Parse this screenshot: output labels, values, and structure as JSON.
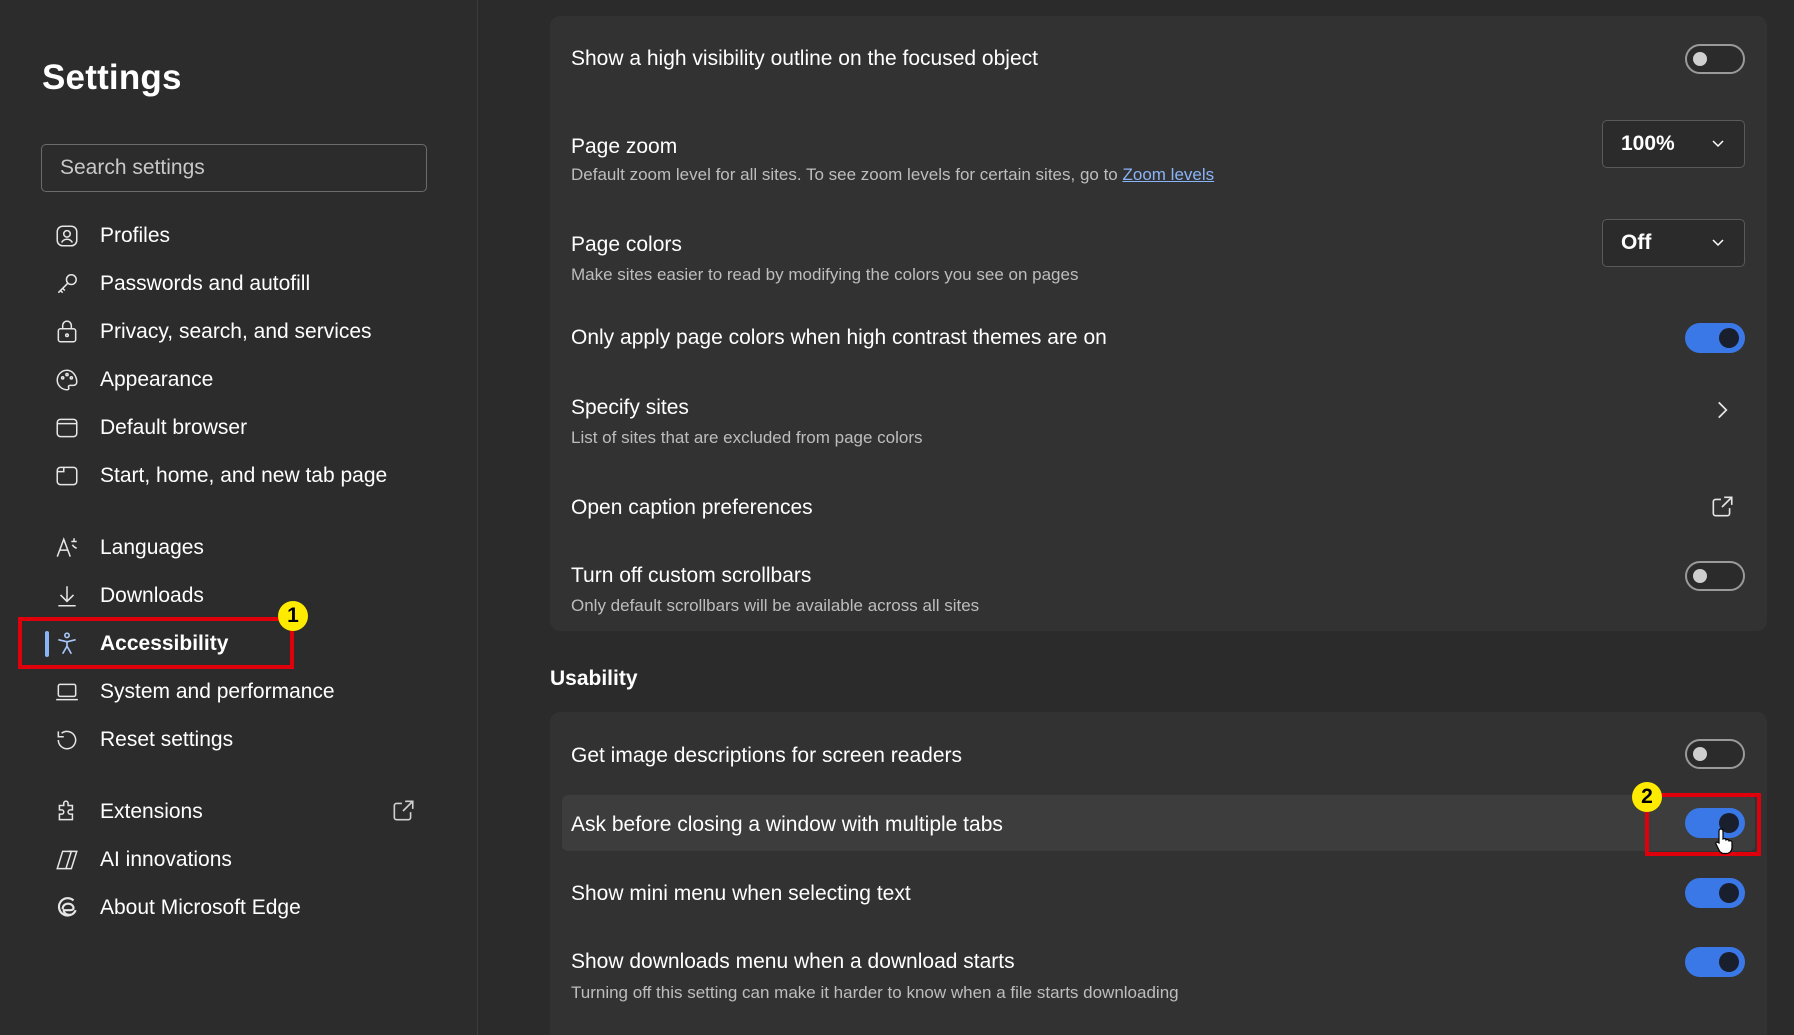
{
  "sidebar": {
    "title": "Settings",
    "search_placeholder": "Search settings",
    "items": [
      {
        "label": "Profiles",
        "icon": "profiles-icon"
      },
      {
        "label": "Passwords and autofill",
        "icon": "key-icon"
      },
      {
        "label": "Privacy, search, and services",
        "icon": "lock-icon"
      },
      {
        "label": "Appearance",
        "icon": "palette-icon"
      },
      {
        "label": "Default browser",
        "icon": "browser-icon"
      },
      {
        "label": "Start, home, and new tab page",
        "icon": "home-page-icon"
      },
      {
        "label": "Languages",
        "icon": "languages-icon"
      },
      {
        "label": "Downloads",
        "icon": "download-icon"
      },
      {
        "label": "Accessibility",
        "icon": "accessibility-icon",
        "active": true
      },
      {
        "label": "System and performance",
        "icon": "laptop-icon"
      },
      {
        "label": "Reset settings",
        "icon": "reset-icon"
      },
      {
        "label": "Extensions",
        "icon": "extensions-icon"
      },
      {
        "label": "AI innovations",
        "icon": "ai-icon"
      },
      {
        "label": "About Microsoft Edge",
        "icon": "edge-icon"
      }
    ]
  },
  "annotations": {
    "badge1": "1",
    "badge2": "2"
  },
  "display": {
    "outline": {
      "title": "Show a high visibility outline on the focused object",
      "enabled": false
    },
    "page_zoom": {
      "title": "Page zoom",
      "desc": "Default zoom level for all sites. To see zoom levels for certain sites, go to ",
      "link": "Zoom levels",
      "value": "100%"
    },
    "page_colors": {
      "title": "Page colors",
      "desc": "Make sites easier to read by modifying the colors you see on pages",
      "value": "Off"
    },
    "only_apply": {
      "title": "Only apply page colors when high contrast themes are on",
      "enabled": true
    },
    "specify_sites": {
      "title": "Specify sites",
      "desc": "List of sites that are excluded from page colors"
    },
    "caption": {
      "title": "Open caption preferences"
    },
    "scrollbars": {
      "title": "Turn off custom scrollbars",
      "desc": "Only default scrollbars will be available across all sites",
      "enabled": false
    }
  },
  "usability": {
    "section_title": "Usability",
    "image_desc": {
      "title": "Get image descriptions for screen readers",
      "enabled": false
    },
    "ask_close": {
      "title": "Ask before closing a window with multiple tabs",
      "enabled": true
    },
    "mini_menu": {
      "title": "Show mini menu when selecting text",
      "enabled": true
    },
    "downloads_menu": {
      "title": "Show downloads menu when a download starts",
      "desc": "Turning off this setting can make it harder to know when a file starts downloading",
      "enabled": true
    }
  },
  "colors": {
    "accent": "#3b78e7",
    "annotation_red": "#e0000b",
    "annotation_yellow": "#ffeb00"
  }
}
